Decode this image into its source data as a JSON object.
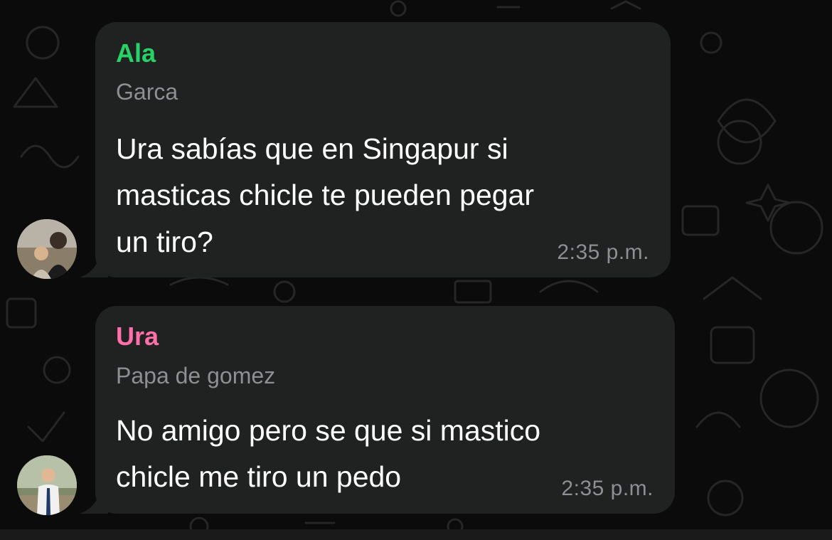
{
  "colors": {
    "background": "#0b0b0b",
    "bubble": "#202121",
    "sender_green": "#25d366",
    "sender_pink": "#ff6fa8",
    "secondary_text": "#8e8e93"
  },
  "messages": [
    {
      "sender": "Ala",
      "sender_color": "#25d366",
      "subtitle": "Garca",
      "lines": [
        "Ura sabías que en Singapur si",
        "masticas chicle te pueden pegar",
        "un tiro?"
      ],
      "time": "2:35 p.m.",
      "avatar_icon": "person-photo-icon"
    },
    {
      "sender": "Ura",
      "sender_color": "#ff6fa8",
      "subtitle": "Papa de gomez",
      "lines": [
        "No amigo pero se que si mastico",
        "chicle me tiro un pedo"
      ],
      "time": "2:35 p.m.",
      "avatar_icon": "person-photo-icon"
    }
  ]
}
